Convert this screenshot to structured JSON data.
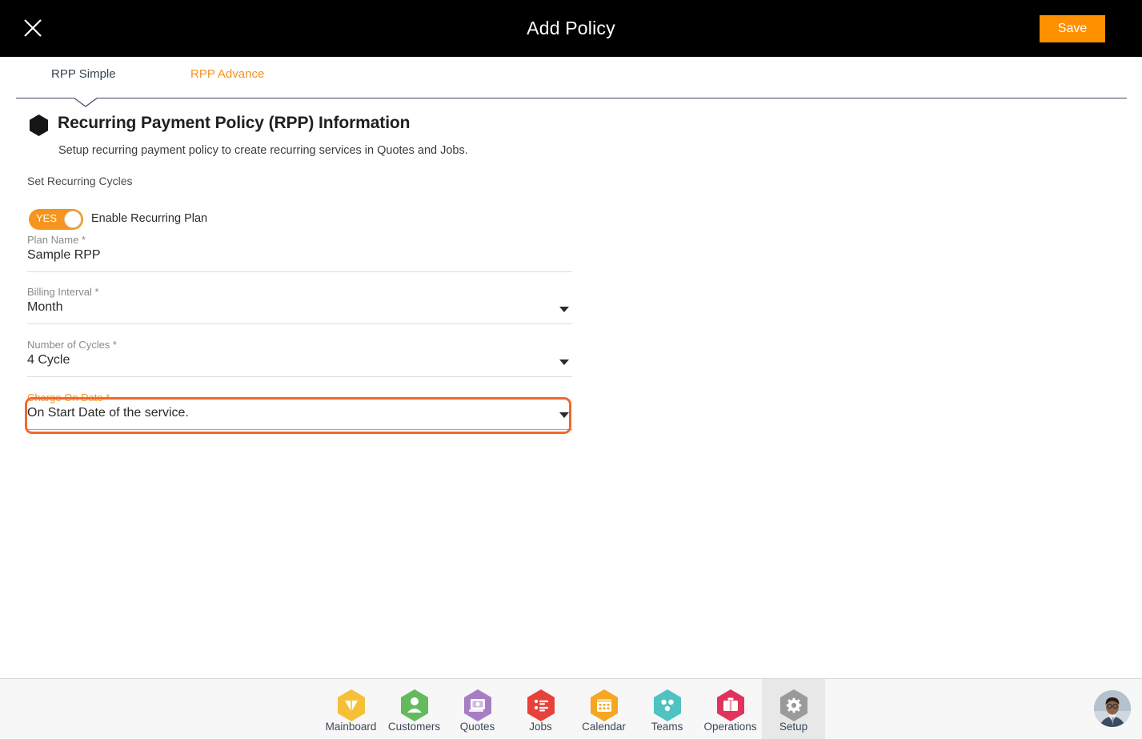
{
  "topbar": {
    "close_icon": "close-icon",
    "title": "Add Policy",
    "save_label": "Save"
  },
  "tabs": [
    {
      "label": "RPP Simple",
      "active": true
    },
    {
      "label": "RPP Advance",
      "active": false
    }
  ],
  "section": {
    "icon": "hexagon-icon",
    "title": "Recurring Payment Policy (RPP) Information",
    "subtitle": "Setup recurring payment policy to create recurring services in Quotes and Jobs.",
    "group_label": "Set Recurring Cycles"
  },
  "toggle": {
    "state_label": "YES",
    "caption": "Enable Recurring Plan"
  },
  "fields": {
    "plan_name": {
      "label": "Plan Name *",
      "value": "Sample RPP"
    },
    "billing": {
      "label": "Billing Interval *",
      "value": "Month"
    },
    "cycles": {
      "label": "Number of Cycles *",
      "value": "4 Cycle"
    },
    "charge_on": {
      "label": "Charge On Date *",
      "value": "On Start Date of the service."
    }
  },
  "highlight": {
    "target": "charge-on-date-field",
    "color": "#f2682a"
  },
  "bottom_nav": [
    {
      "label": "Mainboard",
      "icon": "mainboard-icon",
      "color": "#f5c035",
      "active": false
    },
    {
      "label": "Customers",
      "icon": "customers-icon",
      "color": "#63bb5e",
      "active": false
    },
    {
      "label": "Quotes",
      "icon": "quotes-icon",
      "color": "#a77ec4",
      "active": false
    },
    {
      "label": "Jobs",
      "icon": "jobs-icon",
      "color": "#e8413a",
      "active": false
    },
    {
      "label": "Calendar",
      "icon": "calendar-icon",
      "color": "#f5a623",
      "active": false
    },
    {
      "label": "Teams",
      "icon": "teams-icon",
      "color": "#4ec3c1",
      "active": false
    },
    {
      "label": "Operations",
      "icon": "operations-icon",
      "color": "#e0345c",
      "active": false
    },
    {
      "label": "Setup",
      "icon": "setup-icon",
      "color": "#9a9a9a",
      "active": true
    }
  ],
  "avatar": {
    "name": "user-avatar"
  }
}
